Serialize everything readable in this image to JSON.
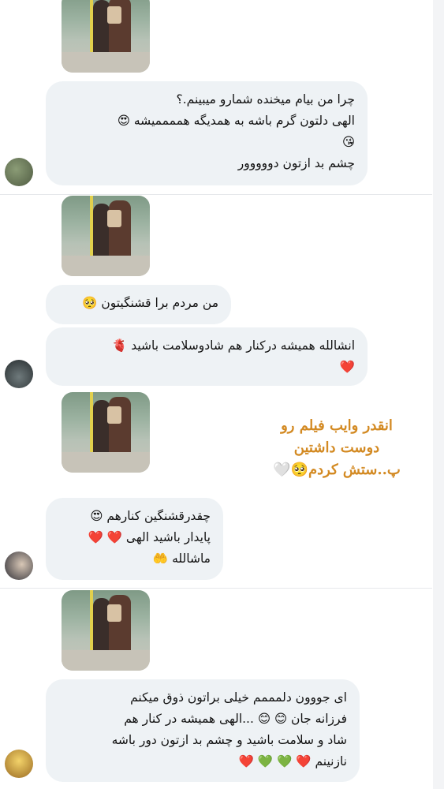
{
  "thread": [
    {
      "reply_lines": [
        "چرا من بیام میخنده شمارو میبینم.؟",
        "الهی دلتون گرم باشه به همدیگه هممممیشه 😍",
        "😘",
        "چشم بد ازتون دووووور"
      ]
    },
    {
      "reply_lines": [
        "من مردم برا قشنگیتون 🥺"
      ],
      "reply2_lines": [
        "انشالله همیشه درکنار هم شادوسلامت باشید 🫀",
        "❤️"
      ]
    },
    {
      "caption_lines": [
        "انقدر وایب فیلم رو",
        "دوست داشتین",
        "پ..ستش کردم🥺🤍"
      ],
      "reply_lines": [
        "چقدرقشنگین کنارهم 😍",
        "پایدار باشید الهی ❤️ ❤️",
        "ماشالله 🤲"
      ]
    },
    {
      "reply_lines": [
        "ای جووون دلمممم خیلی براتون ذوق میکنم",
        "فرزانه جان 😊 😊 ...الهی همیشه در کنار هم",
        "شاد و سلامت باشید و چشم بد ازتون دور باشه",
        "نازنینم ❤️ 💚 💚 ❤️"
      ]
    }
  ],
  "colors": {
    "bubble_bg": "#eef2f5",
    "caption": "#d38a23",
    "divider": "#e6e8eb"
  }
}
